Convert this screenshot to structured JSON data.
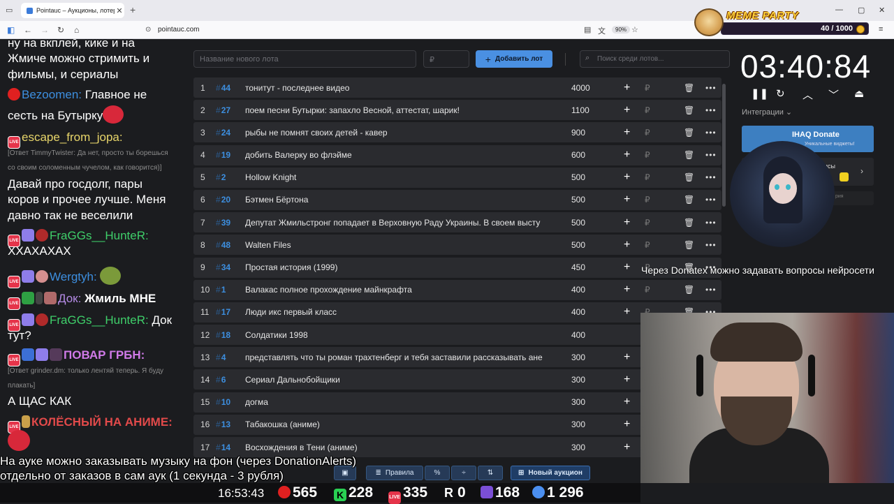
{
  "browser": {
    "tab_title": "Pointauc – Аукционы, лотереи",
    "url": "pointauc.com",
    "zoom": "90%"
  },
  "meme_party": {
    "title": "MEME PARTY",
    "count": "40 / 1000"
  },
  "chat": [
    {
      "type": "text",
      "text": "ну на вкплей, кике и на"
    },
    {
      "type": "text",
      "text": "Жмиче можно стримить и"
    },
    {
      "type": "text",
      "text": "фильмы, и сериалы"
    },
    {
      "type": "msg",
      "nick": "Bezoomen:",
      "nick_color": "#3d8fe0",
      "text": "Главное не"
    },
    {
      "type": "text",
      "text": "сесть на Бутырку"
    },
    {
      "type": "msg",
      "nick": "escape_from_jopa:",
      "nick_color": "#e7d56a",
      "text": ""
    },
    {
      "type": "reply",
      "text": "[Ответ TimmyTwister: Да нет, просто ты борешься"
    },
    {
      "type": "reply",
      "text": "со своим соломенным чучелом, как говорится)]"
    },
    {
      "type": "text",
      "text": "Давай про госдолг, пары"
    },
    {
      "type": "text",
      "text": "коров и прочее лучше. Меня"
    },
    {
      "type": "text",
      "text": "давно так не веселили"
    },
    {
      "type": "msg",
      "nick": "FraGGs__HunteR:",
      "nick_color": "#3fcf6a",
      "text": ""
    },
    {
      "type": "text",
      "text": "ХХАХАХАХ"
    },
    {
      "type": "msg",
      "nick": "Wergtyh:",
      "nick_color": "#3d8fe0",
      "text": ""
    },
    {
      "type": "msg",
      "nick": "Док:",
      "nick_color": "#b58be6",
      "text": "Жмиль МНЕ"
    },
    {
      "type": "msg",
      "nick": "FraGGs__HunteR:",
      "nick_color": "#3fcf6a",
      "text": "Док"
    },
    {
      "type": "text",
      "text": "тут?"
    },
    {
      "type": "msg",
      "nick": "ПОВАР ГРБН:",
      "nick_color": "#d07ae8",
      "text": ""
    },
    {
      "type": "reply",
      "text": "[Ответ grinder.dm: только лентяй теперь. Я буду"
    },
    {
      "type": "reply",
      "text": "плакать]"
    },
    {
      "type": "text",
      "text": "А ЩАС КАК"
    },
    {
      "type": "msg",
      "nick": "КОЛЁСНЫЙ НА АНИМЕ:",
      "nick_color": "#e24a4a",
      "text": ""
    }
  ],
  "app": {
    "new_lot_placeholder": "Название нового лота",
    "price_placeholder": "₽",
    "add_button": "Добавить лот",
    "search_placeholder": "Поиск среди лотов...",
    "lots": [
      {
        "idx": "1",
        "num": "44",
        "name": "тонитут - последнее видео",
        "amount": "4000"
      },
      {
        "idx": "2",
        "num": "27",
        "name": "поем песни Бутырки: запахло Весной, аттестат, шарик!",
        "amount": "1100"
      },
      {
        "idx": "3",
        "num": "24",
        "name": "рыбы не помнят своих детей - кавер",
        "amount": "900"
      },
      {
        "idx": "4",
        "num": "19",
        "name": "добить Валерку во флэйме",
        "amount": "600"
      },
      {
        "idx": "5",
        "num": "2",
        "name": "Hollow Knight",
        "amount": "500"
      },
      {
        "idx": "6",
        "num": "20",
        "name": "Бэтмен Бёртона",
        "amount": "500"
      },
      {
        "idx": "7",
        "num": "39",
        "name": "Депутат Жмильстронг попадает в Верховную Раду Украины. В своем высту",
        "amount": "500"
      },
      {
        "idx": "8",
        "num": "48",
        "name": "Walten Files",
        "amount": "500"
      },
      {
        "idx": "9",
        "num": "34",
        "name": "Простая история (1999)",
        "amount": "450"
      },
      {
        "idx": "10",
        "num": "1",
        "name": "Валакас полное прохождение майнкрафта",
        "amount": "400"
      },
      {
        "idx": "11",
        "num": "17",
        "name": "Люди икс первый класс",
        "amount": "400"
      },
      {
        "idx": "12",
        "num": "18",
        "name": "Солдатики 1998",
        "amount": "400"
      },
      {
        "idx": "13",
        "num": "4",
        "name": "представлять что ты роман трахтенберг и тебя заставили рассказывать ане",
        "amount": "300"
      },
      {
        "idx": "14",
        "num": "6",
        "name": "Сериал Дальнобойщики",
        "amount": "300"
      },
      {
        "idx": "15",
        "num": "10",
        "name": "догма",
        "amount": "300"
      },
      {
        "idx": "16",
        "num": "13",
        "name": "Табакошка (аниме)",
        "amount": "300"
      },
      {
        "idx": "17",
        "num": "14",
        "name": "Восхождения в Тени (аниме)",
        "amount": "300"
      }
    ],
    "rub": "₽",
    "toolbar": {
      "rules": "Правила",
      "new_auction": "Новый аукцион"
    }
  },
  "right_panel": {
    "timer": "03:40:84",
    "integrations": "Интеграции",
    "donate_title": "IHAQ Donate",
    "donate_sub": "Уникальные виджеты!",
    "card2": "исы",
    "card3": "рия"
  },
  "captions": {
    "right": "Через Donatex можно задавать вопросы нейросети",
    "bottom1": "На ауке можно заказывать музыку на фон (через DonationAlerts)",
    "bottom2": "отдельно от заказов в сам аук (1 секунда - 3 рубля)"
  },
  "stats": {
    "time": "16:53:43",
    "youtube": "565",
    "kick": "228",
    "vk_live": "335",
    "rutube": "0",
    "twitch": "168",
    "total": "1 296"
  }
}
